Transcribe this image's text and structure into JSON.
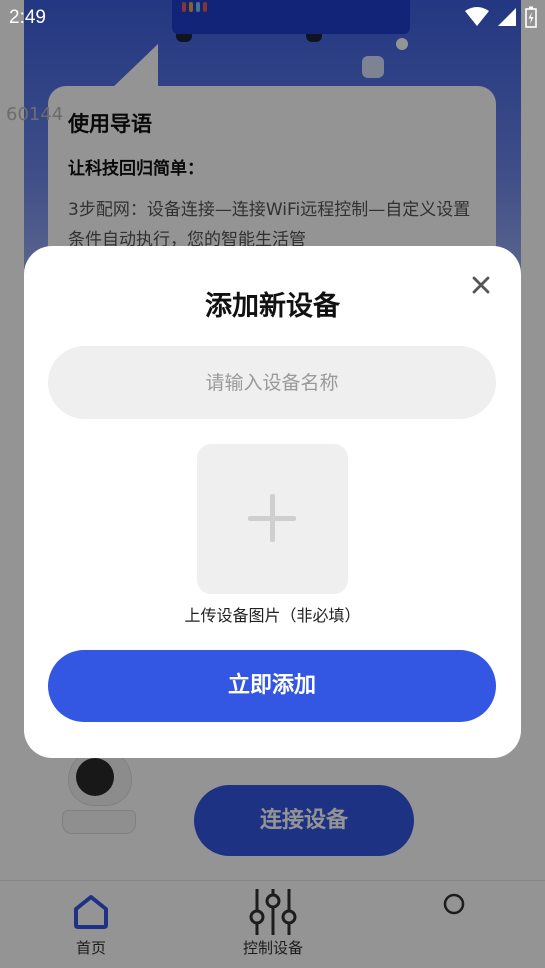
{
  "status_bar": {
    "time": "2:49"
  },
  "hero": {
    "guide_title": "使用导语",
    "guide_subtitle": "让科技回归简单：",
    "guide_body": "3步配网：设备连接—连接WiFi远程控制—自定义设置条件自动执行，您的智能生活管",
    "ghost_number": "60144"
  },
  "main": {
    "connect_button_label": "连接设备"
  },
  "tabbar": {
    "items": [
      {
        "label": "首页",
        "icon": "home-icon"
      },
      {
        "label": "控制设备",
        "icon": "sliders-icon"
      },
      {
        "label": "",
        "icon": "profile-icon"
      }
    ]
  },
  "dialog": {
    "title": "添加新设备",
    "name_placeholder": "请输入设备名称",
    "name_value": "",
    "upload_label": "上传设备图片（非必填）",
    "submit_label": "立即添加",
    "close_icon": "close-icon",
    "upload_icon": "plus-icon"
  },
  "colors": {
    "primary": "#3457e3",
    "scrim": "rgba(0,0,0,0.42)",
    "input_bg": "#efefef"
  }
}
